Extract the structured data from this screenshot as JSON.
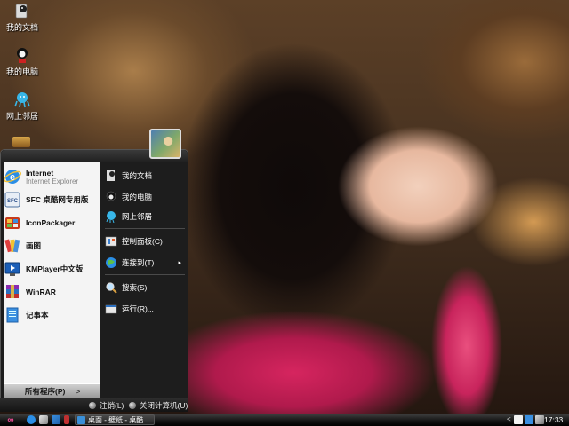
{
  "desktop": {
    "icons": [
      {
        "label": "我的文档",
        "icon": "my-documents-icon"
      },
      {
        "label": "我的电脑",
        "icon": "my-computer-icon"
      },
      {
        "label": "网上邻居",
        "icon": "network-icon"
      }
    ]
  },
  "start_menu": {
    "pinned": {
      "title": "Internet",
      "subtitle": "Internet Explorer",
      "icon": "internet-explorer-icon"
    },
    "programs": [
      {
        "label": "SFC 桌酷网专用版",
        "icon": "sfc-icon"
      },
      {
        "label": "IconPackager",
        "icon": "iconpackager-icon"
      },
      {
        "label": "画图",
        "icon": "paint-icon"
      },
      {
        "label": "KMPlayer中文版",
        "icon": "kmplayer-icon"
      },
      {
        "label": "WinRAR",
        "icon": "winrar-icon"
      },
      {
        "label": "记事本",
        "icon": "notepad-icon"
      }
    ],
    "all_programs": "所有程序(P)",
    "all_programs_arrow": ">",
    "places": [
      {
        "label": "我的文档",
        "icon": "my-documents-icon"
      },
      {
        "label": "我的电脑",
        "icon": "my-computer-icon"
      },
      {
        "label": "网上邻居",
        "icon": "network-icon"
      },
      {
        "label": "控制面板(C)",
        "icon": "control-panel-icon"
      },
      {
        "label": "连接到(T)",
        "icon": "connect-icon",
        "submenu": "▸"
      },
      {
        "label": "搜索(S)",
        "icon": "search-icon"
      },
      {
        "label": "运行(R)...",
        "icon": "run-icon"
      }
    ],
    "footer": {
      "logoff": "注销(L)",
      "shutdown": "关闭计算机(U)"
    }
  },
  "taskbar": {
    "start_glyph": "∞",
    "task_label": "桌面 - 壁纸 - 桌酷...",
    "clock": "17:33"
  },
  "colors": {
    "menu_dark": "#1d1d1d",
    "menu_light": "#f4f4f4",
    "taskbar": "#111111",
    "start_accent": "#ff4fa0"
  }
}
